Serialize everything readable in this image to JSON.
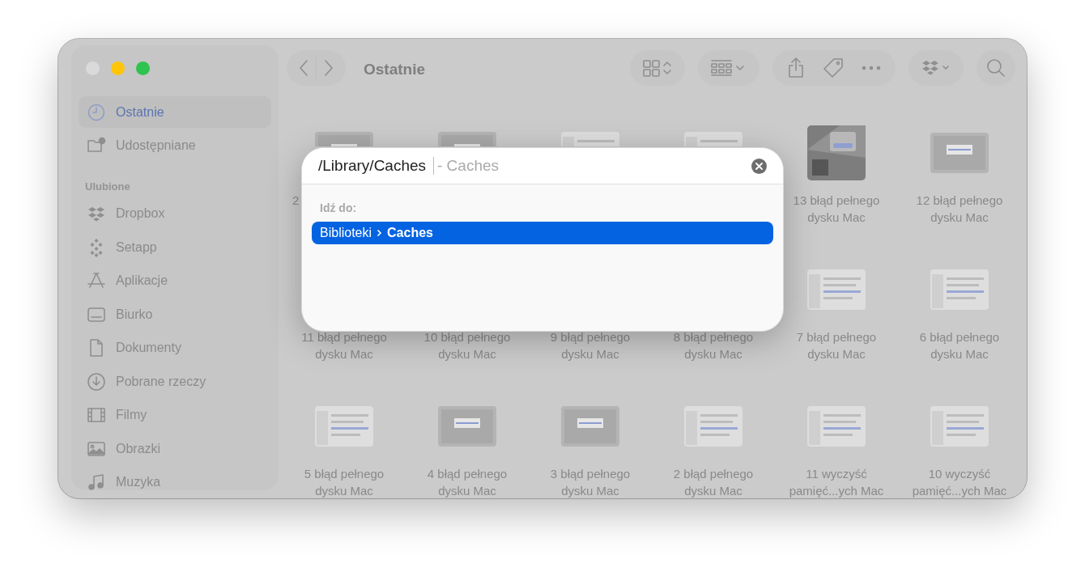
{
  "toolbar": {
    "title": "Ostatnie"
  },
  "sidebar": {
    "top_items": [
      {
        "label": "Ostatnie",
        "selected": true
      },
      {
        "label": "Udostępniane",
        "selected": false
      }
    ],
    "section_title": "Ulubione",
    "items": [
      {
        "label": "Dropbox",
        "selected": false
      },
      {
        "label": "Setapp",
        "selected": false
      },
      {
        "label": "Aplikacje",
        "selected": false
      },
      {
        "label": "Biurko",
        "selected": false
      },
      {
        "label": "Dokumenty",
        "selected": false
      },
      {
        "label": "Pobrane rzeczy",
        "selected": false
      },
      {
        "label": "Filmy",
        "selected": false
      },
      {
        "label": "Obrazki",
        "selected": false
      },
      {
        "label": "Muzyka",
        "selected": false
      }
    ]
  },
  "files": [
    {
      "kind": "dialog",
      "label": [
        "2"
      ]
    },
    {
      "kind": "dialog"
    },
    {
      "kind": "window"
    },
    {
      "kind": "window"
    },
    {
      "kind": "dark",
      "label": [
        "13 błąd pełnego",
        "dysku Mac"
      ]
    },
    {
      "kind": "dialog",
      "label": [
        "12 błąd pełnego",
        "dysku Mac"
      ]
    },
    {
      "label": [
        "11 błąd pełnego",
        "dysku Mac"
      ]
    },
    {
      "label": [
        "10 błąd pełnego",
        "dysku Mac"
      ]
    },
    {
      "label": [
        "9 błąd pełnego",
        "dysku Mac"
      ]
    },
    {
      "label": [
        "8 błąd pełnego",
        "dysku Mac"
      ]
    },
    {
      "kind": "window",
      "label": [
        "7 błąd pełnego",
        "dysku Mac"
      ]
    },
    {
      "kind": "window",
      "label": [
        "6 błąd pełnego",
        "dysku Mac"
      ]
    },
    {
      "kind": "window",
      "label": [
        "5 błąd pełnego",
        "dysku Mac"
      ]
    },
    {
      "kind": "dialog",
      "label": [
        "4 błąd pełnego",
        "dysku Mac"
      ]
    },
    {
      "kind": "dialog",
      "label": [
        "3 błąd pełnego",
        "dysku Mac"
      ]
    },
    {
      "kind": "window",
      "label": [
        "2 błąd pełnego",
        "dysku Mac"
      ]
    },
    {
      "kind": "window",
      "label": [
        "11 wyczyść",
        "pamięć...ych Mac"
      ]
    },
    {
      "kind": "window",
      "label": [
        "10 wyczyść",
        "pamięć...ych Mac"
      ]
    }
  ],
  "goto_dialog": {
    "value": "/Library/Caches",
    "completion": "- Caches",
    "section_label": "Idź do:",
    "results": [
      {
        "path": [
          "Biblioteki",
          "Caches"
        ],
        "selected": true
      }
    ]
  }
}
